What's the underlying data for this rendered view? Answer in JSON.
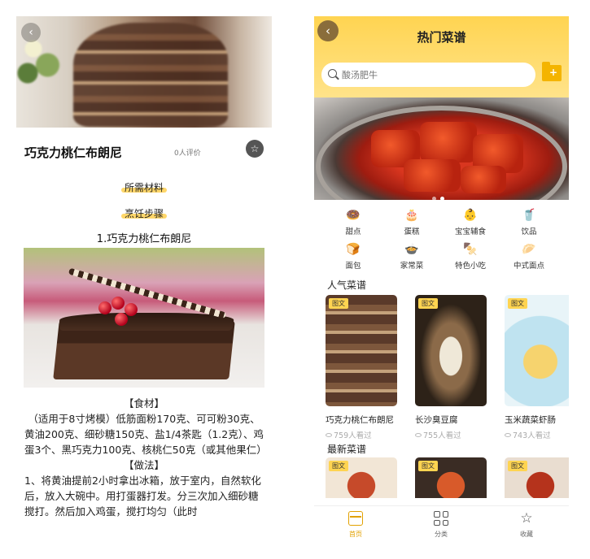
{
  "detail": {
    "back_glyph": "‹",
    "title": "巧克力桃仁布朗尼",
    "review_count": "0人评价",
    "fav_glyph": "☆",
    "ingredients_label": "所需材料",
    "steps_label": "烹饪步骤",
    "step1_title": "1.巧克力桃仁布朗尼",
    "ingredients_heading": "【食材】",
    "ingredients_text": "（适用于8寸烤模）低筋面粉170克、可可粉30克、黄油200克、细砂糖150克、盐1/4茶匙（1.2克）、鸡蛋3个、黑巧克力100克、核桃仁50克（或其他果仁）",
    "method_heading": "【做法】",
    "method_text": "1、将黄油提前2小时拿出冰箱，放于室内，自然软化后，放入大碗中。用打蛋器打发。分三次加入细砂糖搅打。然后加入鸡蛋，搅打均匀（此时"
  },
  "home": {
    "back_glyph": "‹",
    "title": "热门菜谱",
    "search_placeholder": "酸汤肥牛",
    "categories": [
      {
        "label": "甜点",
        "icon": "donut-icon",
        "glyph": "🍩"
      },
      {
        "label": "蛋糕",
        "icon": "cake-icon",
        "glyph": "🎂"
      },
      {
        "label": "宝宝辅食",
        "icon": "baby-icon",
        "glyph": "👶"
      },
      {
        "label": "饮品",
        "icon": "drink-icon",
        "glyph": "🥤"
      },
      {
        "label": "面包",
        "icon": "bread-icon",
        "glyph": "🍞"
      },
      {
        "label": "家常菜",
        "icon": "pot-icon",
        "glyph": "🍲"
      },
      {
        "label": "特色小吃",
        "icon": "snack-icon",
        "glyph": "🍢"
      },
      {
        "label": "中式面点",
        "icon": "bun-icon",
        "glyph": "🥟"
      }
    ],
    "popular_title": "人气菜谱",
    "popular": [
      {
        "tag": "图文",
        "name": "巧克力桃仁布朗尼",
        "views": "759人看过"
      },
      {
        "tag": "图文",
        "name": "长沙臭豆腐",
        "views": "755人看过"
      },
      {
        "tag": "图文",
        "name": "玉米蔬菜虾肠",
        "views": "743人看过"
      }
    ],
    "latest_title": "最新菜谱",
    "latest": [
      {
        "tag": "图文"
      },
      {
        "tag": "图文"
      },
      {
        "tag": "图文"
      }
    ],
    "tabs": [
      {
        "label": "首页"
      },
      {
        "label": "分类"
      },
      {
        "label": "收藏"
      }
    ]
  },
  "colors": {
    "accent_yellow": "#ffd451",
    "active_tab": "#e2a100",
    "highlight": "#ffd76a"
  }
}
